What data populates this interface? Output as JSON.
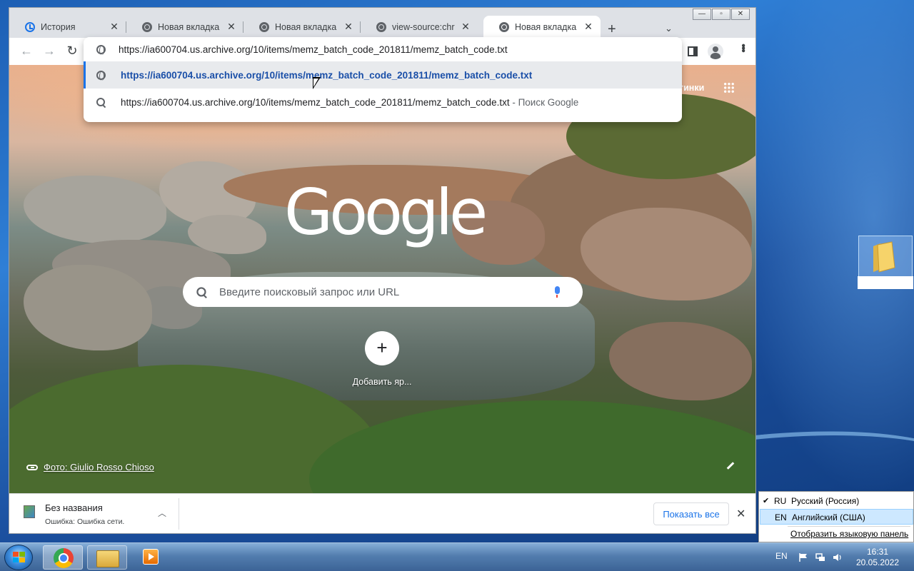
{
  "browser": {
    "tabs": [
      {
        "title": "История",
        "icon": "history-icon",
        "active": false
      },
      {
        "title": "Новая вкладка",
        "icon": "chrome-icon",
        "active": false
      },
      {
        "title": "Новая вкладка",
        "icon": "chrome-icon",
        "active": false
      },
      {
        "title": "view-source:chrom",
        "icon": "chrome-icon",
        "active": false
      },
      {
        "title": "Новая вкладка",
        "icon": "chrome-icon",
        "active": true
      }
    ],
    "tab_close_glyph": "✕",
    "new_tab_glyph": "+",
    "tab_search_glyph": "⌄",
    "window_controls": {
      "minimize": "—",
      "maximize": "▫",
      "close": "✕"
    },
    "nav": {
      "back": "←",
      "forward": "→",
      "reload": "↻"
    },
    "omnibox": {
      "value": "https://ia600704.us.archive.org/10/items/memz_batch_code_201811/memz_batch_code.txt",
      "suggestions": [
        {
          "type": "url",
          "text": "https://ia600704.us.archive.org/10/items/memz_batch_code_201811/memz_batch_code.txt",
          "suffix": ""
        },
        {
          "type": "search",
          "text": "https://ia600704.us.archive.org/10/items/memz_batch_code_201811/memz_batch_code.txt",
          "suffix": " - Поиск Google"
        }
      ]
    }
  },
  "ntp": {
    "logo": "Google",
    "images_link": "тинки",
    "search_placeholder": "Введите поисковый запрос или URL",
    "shortcut_add_glyph": "+",
    "shortcut_add_label": "Добавить яр...",
    "photo_credit": "Фото: Giulio Rosso Chioso"
  },
  "downloads": {
    "item_name": "Без названия",
    "item_status": "Ошибка: Ошибка сети.",
    "chevron": "︿",
    "show_all_label": "Показать все",
    "close_glyph": "✕"
  },
  "language_menu": {
    "items": [
      {
        "code": "RU",
        "name": "Русский (Россия)",
        "checked": true
      },
      {
        "code": "EN",
        "name": "Английский (США)",
        "checked": false
      }
    ],
    "check_glyph": "✔",
    "show_bar_label": "Отобразить языковую панель"
  },
  "taskbar": {
    "lang": "EN",
    "time": "16:31",
    "date": "20.05.2022"
  },
  "colors": {
    "accent": "#1a73e8",
    "selected_suggestion": "#1a4fa8",
    "tab_strip": "#dee1e6"
  }
}
